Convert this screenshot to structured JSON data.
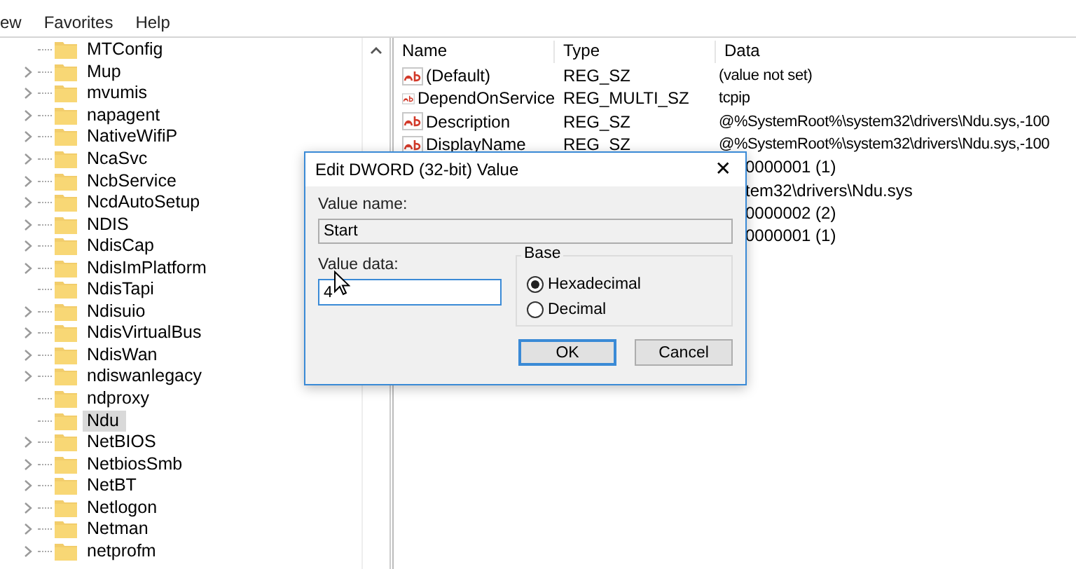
{
  "menu": [
    "ew",
    "Favorites",
    "Help"
  ],
  "tree": [
    {
      "label": "MTConfig",
      "expandable": false,
      "selected": false
    },
    {
      "label": "Mup",
      "expandable": true,
      "selected": false
    },
    {
      "label": "mvumis",
      "expandable": true,
      "selected": false
    },
    {
      "label": "napagent",
      "expandable": true,
      "selected": false
    },
    {
      "label": "NativeWifiP",
      "expandable": true,
      "selected": false
    },
    {
      "label": "NcaSvc",
      "expandable": true,
      "selected": false
    },
    {
      "label": "NcbService",
      "expandable": true,
      "selected": false
    },
    {
      "label": "NcdAutoSetup",
      "expandable": true,
      "selected": false
    },
    {
      "label": "NDIS",
      "expandable": true,
      "selected": false
    },
    {
      "label": "NdisCap",
      "expandable": true,
      "selected": false
    },
    {
      "label": "NdisImPlatform",
      "expandable": true,
      "selected": false
    },
    {
      "label": "NdisTapi",
      "expandable": false,
      "selected": false
    },
    {
      "label": "Ndisuio",
      "expandable": true,
      "selected": false
    },
    {
      "label": "NdisVirtualBus",
      "expandable": true,
      "selected": false
    },
    {
      "label": "NdisWan",
      "expandable": true,
      "selected": false
    },
    {
      "label": "ndiswanlegacy",
      "expandable": true,
      "selected": false
    },
    {
      "label": "ndproxy",
      "expandable": false,
      "selected": false
    },
    {
      "label": "Ndu",
      "expandable": false,
      "selected": true
    },
    {
      "label": "NetBIOS",
      "expandable": true,
      "selected": false
    },
    {
      "label": "NetbiosSmb",
      "expandable": true,
      "selected": false
    },
    {
      "label": "NetBT",
      "expandable": true,
      "selected": false
    },
    {
      "label": "Netlogon",
      "expandable": true,
      "selected": false
    },
    {
      "label": "Netman",
      "expandable": true,
      "selected": false
    },
    {
      "label": "netprofm",
      "expandable": true,
      "selected": false
    }
  ],
  "values": {
    "columns": [
      "Name",
      "Type",
      "Data"
    ],
    "rows": [
      {
        "kind": "full",
        "name": "(Default)",
        "type": "REG_SZ",
        "data": "(value not set)"
      },
      {
        "kind": "full",
        "name": "DependOnService",
        "type": "REG_MULTI_SZ",
        "data": "tcpip"
      },
      {
        "kind": "full",
        "name": "Description",
        "type": "REG_SZ",
        "data": "@%SystemRoot%\\system32\\drivers\\Ndu.sys,-100"
      },
      {
        "kind": "full",
        "name": "DisplayName",
        "type": "REG_SZ",
        "data": "@%SystemRoot%\\system32\\drivers\\Ndu.sys,-100"
      },
      {
        "kind": "partial",
        "data": "0000001 (1)"
      },
      {
        "kind": "partial",
        "data": "tem32\\drivers\\Ndu.sys"
      },
      {
        "kind": "partial",
        "data": "0000002 (2)"
      },
      {
        "kind": "partial",
        "data": "0000001 (1)"
      }
    ]
  },
  "dialog": {
    "title": "Edit DWORD (32-bit) Value",
    "close": "✕",
    "name_label": "Value name:",
    "name_value": "Start",
    "data_label": "Value data:",
    "data_value": "4",
    "base_label": "Base",
    "base_options": [
      {
        "label": "Hexadecimal",
        "selected": true
      },
      {
        "label": "Decimal",
        "selected": false
      }
    ],
    "buttons": [
      {
        "label": "OK",
        "default": true
      },
      {
        "label": "Cancel",
        "default": false
      }
    ]
  }
}
